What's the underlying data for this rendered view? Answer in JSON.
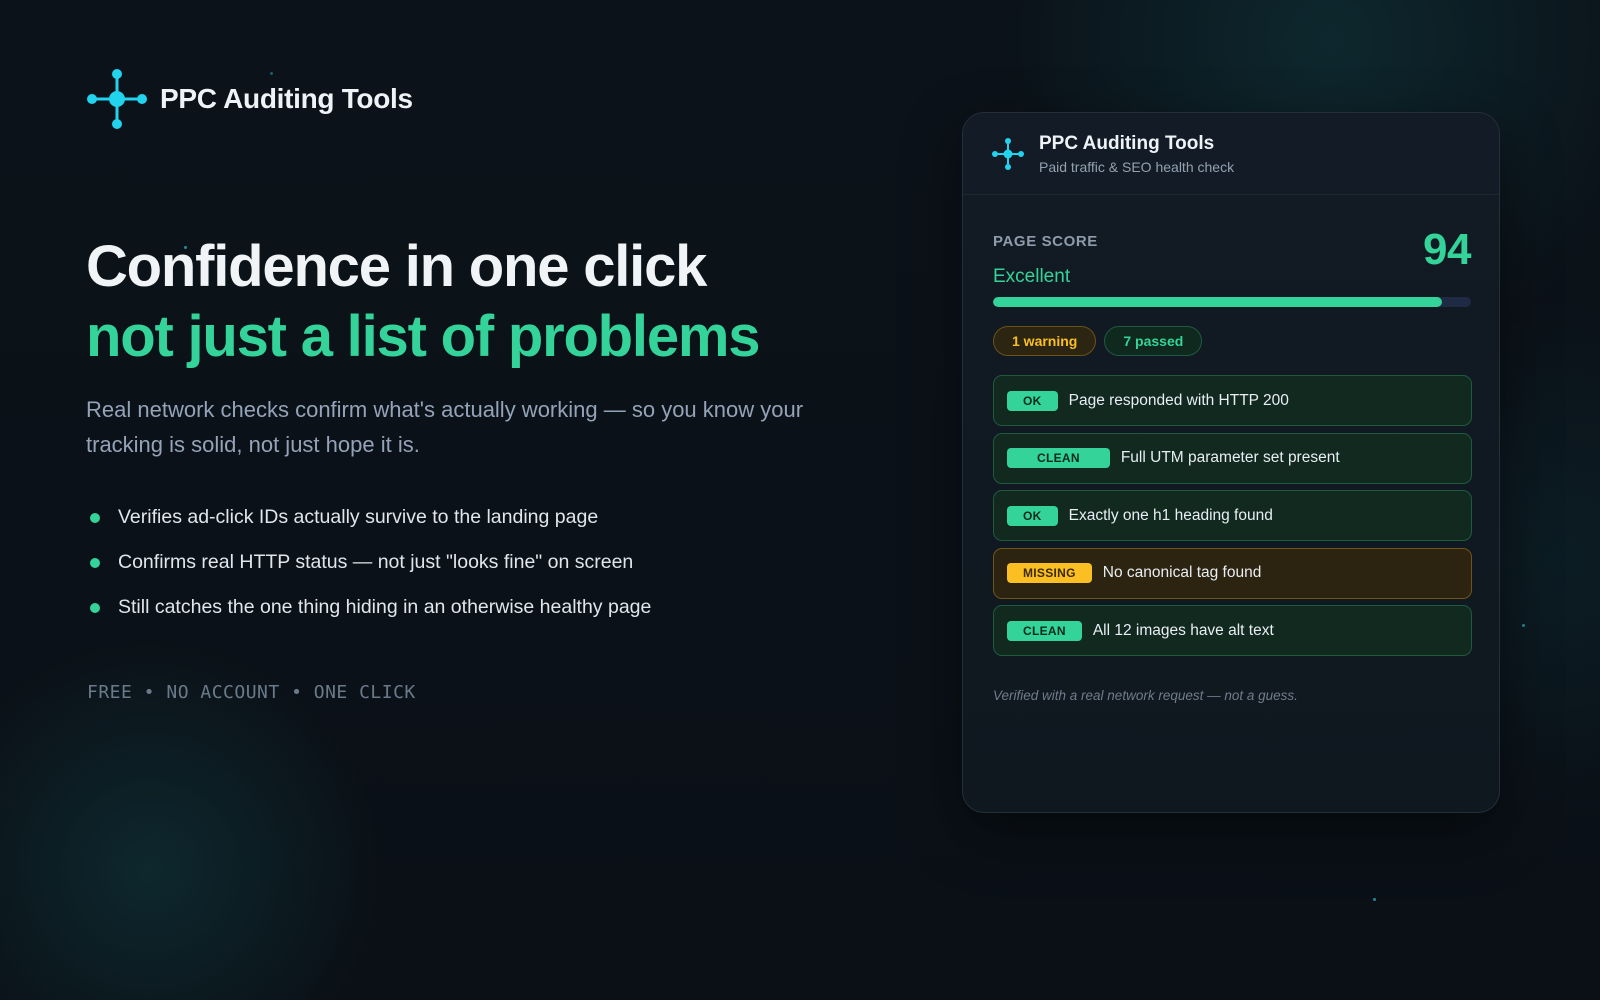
{
  "brand": {
    "name": "PPC Auditing Tools",
    "logo_icon": "network-hub-icon"
  },
  "hero": {
    "headline_line1": "Confidence in one click",
    "headline_line2": "not just a list of problems",
    "lead": "Real network checks confirm what's actually working — so you know your tracking is solid, not just hope it is."
  },
  "features": [
    "Verifies ad-click IDs actually survive to the landing page",
    "Confirms real HTTP status — not just \"looks fine\" on screen",
    "Still catches the one thing hiding in an otherwise healthy page"
  ],
  "tagline": "FREE • NO ACCOUNT • ONE CLICK",
  "card": {
    "title": "PPC Auditing Tools",
    "subtitle": "Paid traffic & SEO health check",
    "score_label": "PAGE SCORE",
    "score": "94",
    "score_fraction": 0.94,
    "score_word": "Excellent",
    "badges": {
      "warning": "1 warning",
      "passed": "7 passed"
    },
    "checks": [
      {
        "tag": "OK",
        "text": "Page responded with HTTP 200",
        "status": "good"
      },
      {
        "tag": "CLEAN",
        "text": "Full UTM parameter set present",
        "status": "good"
      },
      {
        "tag": "OK",
        "text": "Exactly one h1 heading found",
        "status": "good"
      },
      {
        "tag": "MISSING",
        "text": "No canonical tag found",
        "status": "warn"
      },
      {
        "tag": "CLEAN",
        "text": "All 12 images have alt text",
        "status": "good"
      }
    ],
    "footnote": "Verified with a real network request — not a guess."
  },
  "colors": {
    "accent": "#34d399",
    "warning": "#fbbf24",
    "logo": "#22d3ee",
    "background": "#0b1219"
  }
}
